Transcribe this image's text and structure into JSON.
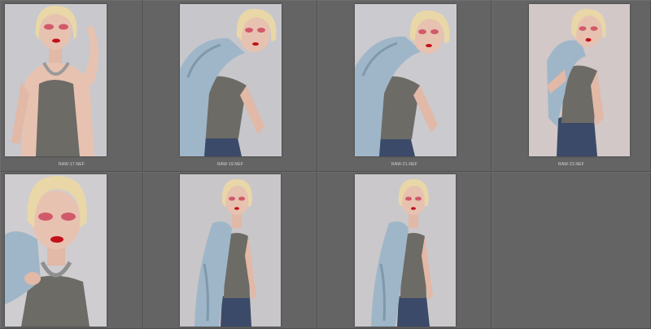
{
  "grid": {
    "background": "#626262",
    "cells": [
      {
        "filename": "RAW-17.NEF",
        "pose": "hand-on-head",
        "bg": "#c9c8cc"
      },
      {
        "filename": "RAW-19.NEF",
        "pose": "jacket-shoulder-lean",
        "bg": "#c7c6cb"
      },
      {
        "filename": "RAW-21.NEF",
        "pose": "jacket-shoulder-lean",
        "bg": "#cbcacf"
      },
      {
        "filename": "RAW-23.NEF",
        "pose": "jacket-back-hunch",
        "bg": "#d2c8c8"
      },
      {
        "filename": "",
        "pose": "closeup-jacket",
        "bg": "#cfcdd0"
      },
      {
        "filename": "",
        "pose": "standing-jacket",
        "bg": "#c8c6c9"
      },
      {
        "filename": "",
        "pose": "standing-jacket",
        "bg": "#cac8cb"
      },
      {
        "filename": "",
        "pose": "empty",
        "bg": ""
      }
    ]
  },
  "colors": {
    "hair": "#e9d7a8",
    "skin": "#e8c2b0",
    "tank": "#6c6b66",
    "denim_jacket": "#9fb6c8",
    "jeans": "#3b4a68",
    "lips": "#c1121c",
    "eye_makeup": "#d05a6a"
  }
}
